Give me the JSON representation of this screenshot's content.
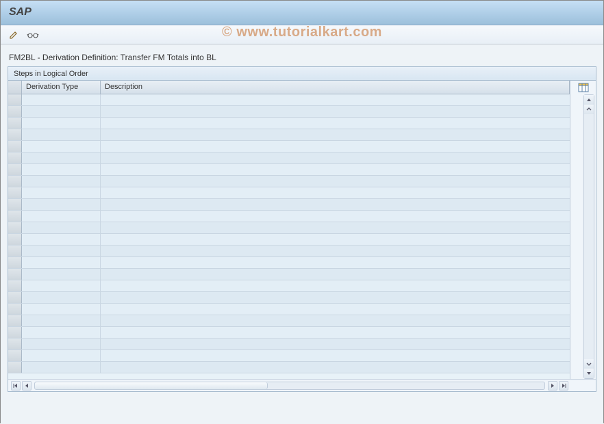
{
  "app": {
    "title": "SAP"
  },
  "toolbar": {
    "edit_icon": "pencil-icon",
    "glasses_icon": "display-icon"
  },
  "page": {
    "heading": "FM2BL - Derivation Definition: Transfer FM Totals into BL",
    "panel_title": "Steps in Logical Order"
  },
  "grid": {
    "columns": {
      "derivation_type": "Derivation Type",
      "description": "Description"
    },
    "rows": [
      {
        "derivation_type": "",
        "description": ""
      },
      {
        "derivation_type": "",
        "description": ""
      },
      {
        "derivation_type": "",
        "description": ""
      },
      {
        "derivation_type": "",
        "description": ""
      },
      {
        "derivation_type": "",
        "description": ""
      },
      {
        "derivation_type": "",
        "description": ""
      },
      {
        "derivation_type": "",
        "description": ""
      },
      {
        "derivation_type": "",
        "description": ""
      },
      {
        "derivation_type": "",
        "description": ""
      },
      {
        "derivation_type": "",
        "description": ""
      },
      {
        "derivation_type": "",
        "description": ""
      },
      {
        "derivation_type": "",
        "description": ""
      },
      {
        "derivation_type": "",
        "description": ""
      },
      {
        "derivation_type": "",
        "description": ""
      },
      {
        "derivation_type": "",
        "description": ""
      },
      {
        "derivation_type": "",
        "description": ""
      },
      {
        "derivation_type": "",
        "description": ""
      },
      {
        "derivation_type": "",
        "description": ""
      },
      {
        "derivation_type": "",
        "description": ""
      },
      {
        "derivation_type": "",
        "description": ""
      },
      {
        "derivation_type": "",
        "description": ""
      },
      {
        "derivation_type": "",
        "description": ""
      },
      {
        "derivation_type": "",
        "description": ""
      },
      {
        "derivation_type": "",
        "description": ""
      }
    ]
  },
  "watermark": "© www.tutorialkart.com"
}
